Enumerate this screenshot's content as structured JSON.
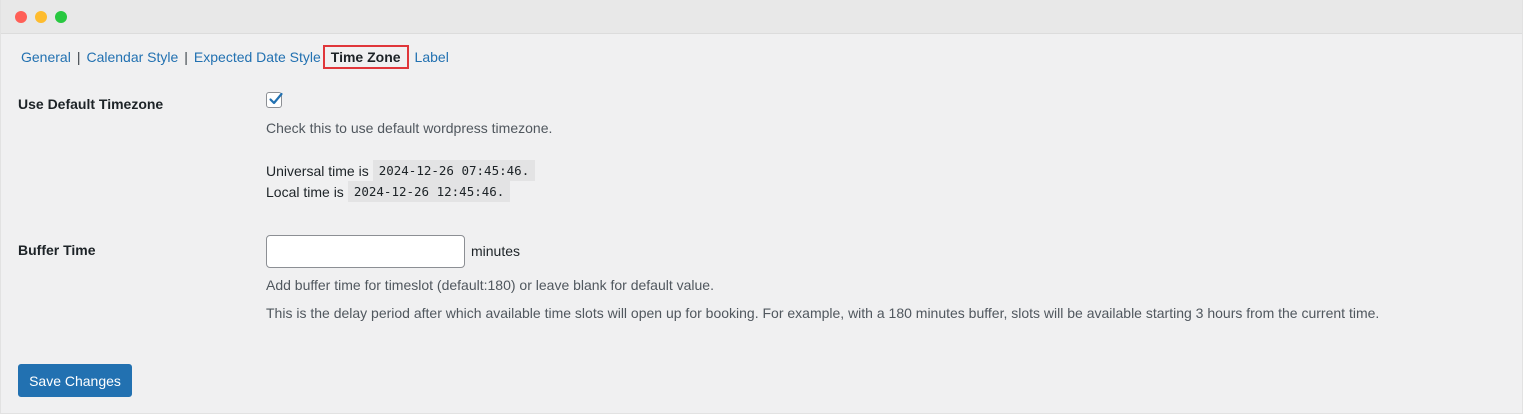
{
  "tabs": [
    {
      "label": "General"
    },
    {
      "label": "Calendar Style"
    },
    {
      "label": "Expected Date Style"
    },
    {
      "label": "Time Zone",
      "active": true
    },
    {
      "label": "Label"
    }
  ],
  "separator": "|",
  "timezone": {
    "label": "Use Default Timezone",
    "checked": true,
    "description": "Check this to use default wordpress timezone.",
    "universal_prefix": "Universal time is",
    "universal_value": "2024-12-26 07:45:46.",
    "local_prefix": "Local time is",
    "local_value": "2024-12-26 12:45:46."
  },
  "buffer": {
    "label": "Buffer Time",
    "value": "",
    "unit": "minutes",
    "help1": "Add buffer time for timeslot (default:180) or leave blank for default value.",
    "help2": "This is the delay period after which available time slots will open up for booking. For example, with a 180 minutes buffer, slots will be available starting 3 hours from the current time."
  },
  "actions": {
    "save_label": "Save Changes"
  },
  "colors": {
    "accent": "#2271b1",
    "highlight_border": "#e0363a",
    "background": "#f0f0f1"
  }
}
